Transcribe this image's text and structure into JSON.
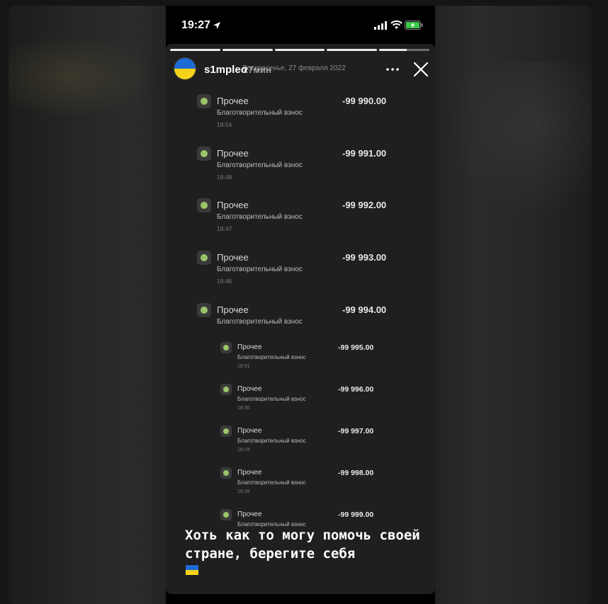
{
  "status_bar": {
    "time": "19:27"
  },
  "story": {
    "username": "s1mpleo",
    "time_ago": "27мин",
    "ghost_date": "Воскресенье, 27 февраля 2022",
    "progress_segments": 5,
    "caption": "Хоть как то могу помочь своей стране, берегите себя"
  },
  "transactions": [
    {
      "title": "Прочее",
      "desc": "Благотворительный взнос",
      "time": "18:54",
      "amount": "-99 990.00",
      "size": "big"
    },
    {
      "title": "Прочее",
      "desc": "Благотворительный взнос",
      "time": "18:48",
      "amount": "-99 991.00",
      "size": "big"
    },
    {
      "title": "Прочее",
      "desc": "Благотворительный взнос",
      "time": "18:47",
      "amount": "-99 992.00",
      "size": "big"
    },
    {
      "title": "Прочее",
      "desc": "Благотворительный взнос",
      "time": "18:46",
      "amount": "-99 993.00",
      "size": "big"
    },
    {
      "title": "Прочее",
      "desc": "Благотворительный взнос",
      "time": "",
      "amount": "-99 994.00",
      "size": "big"
    },
    {
      "title": "Прочее",
      "desc": "Благотворительный взнос",
      "time": "18:31",
      "amount": "-99 995.00",
      "size": "small"
    },
    {
      "title": "Прочее",
      "desc": "Благотворительный взнос",
      "time": "18:30",
      "amount": "-99 996.00",
      "size": "small"
    },
    {
      "title": "Прочее",
      "desc": "Благотворительный взнос",
      "time": "18:29",
      "amount": "-99 997.00",
      "size": "small"
    },
    {
      "title": "Прочее",
      "desc": "Благотворительный взнос",
      "time": "18:28",
      "amount": "-99 998.00",
      "size": "small"
    },
    {
      "title": "Прочее",
      "desc": "Благотворительный взнос",
      "time": "",
      "amount": "-99 999.00",
      "size": "small"
    }
  ],
  "colors": {
    "story_bg": "#1f1f1f",
    "flag_blue": "#1f6bd6",
    "flag_yellow": "#f7d419",
    "tx_icon": "#9bc46a"
  },
  "icons": {
    "location": "location-arrow-icon",
    "signal": "cellular-signal-icon",
    "wifi": "wifi-icon",
    "battery": "battery-charging-icon",
    "more": "more-horizontal-icon",
    "close": "close-icon"
  }
}
